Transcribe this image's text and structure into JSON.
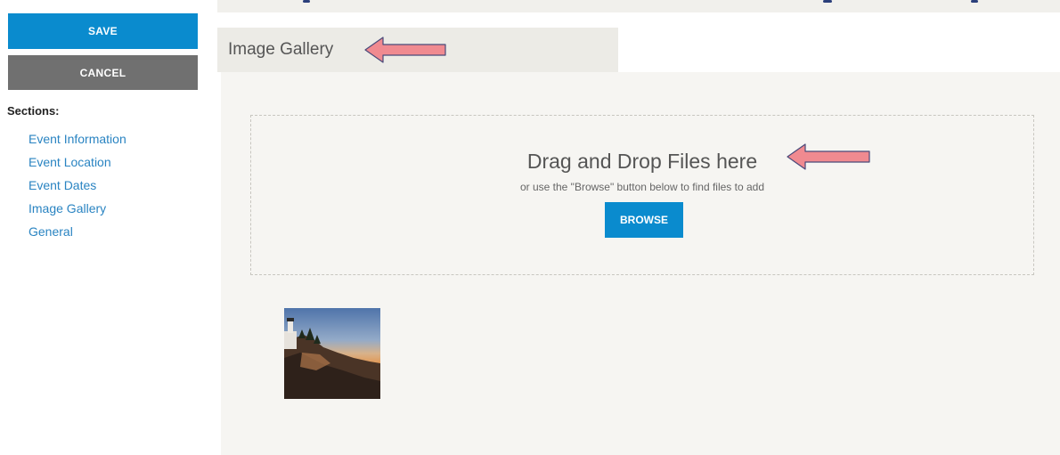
{
  "sidebar": {
    "save_label": "SAVE",
    "cancel_label": "CANCEL",
    "sections_label": "Sections:",
    "items": [
      {
        "label": "Event Information"
      },
      {
        "label": "Event Location"
      },
      {
        "label": "Event Dates"
      },
      {
        "label": "Image Gallery"
      },
      {
        "label": "General"
      }
    ]
  },
  "tab": {
    "title": "Image Gallery"
  },
  "dropzone": {
    "title": "Drag and Drop Files here",
    "subtitle": "or use the \"Browse\" button below to find files to add",
    "browse_label": "BROWSE"
  },
  "gallery": {
    "thumbnails": [
      {
        "icon": "lighthouse-photo"
      }
    ]
  },
  "colors": {
    "primary_button": "#0a8bce",
    "cancel_button": "#707070",
    "link": "#2a84c2",
    "content_background": "#f6f5f2",
    "annotation_arrow": "#f08a90"
  }
}
